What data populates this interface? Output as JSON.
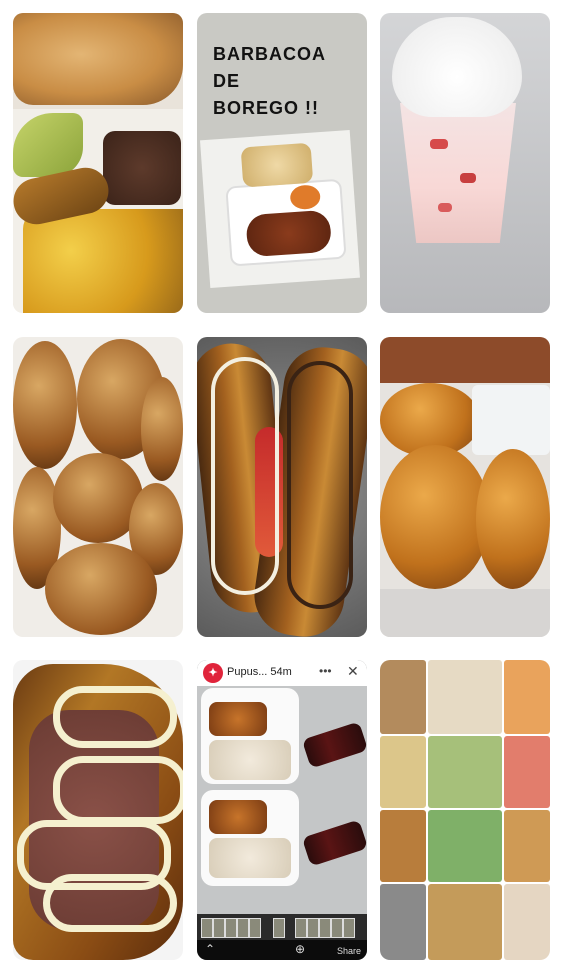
{
  "tiles": [
    {
      "id": "plate-breakfast"
    },
    {
      "id": "barbacoa",
      "headline_lines": [
        "BARBACOA",
        "DE",
        "BOREGO !!"
      ]
    },
    {
      "id": "dessert-cup"
    },
    {
      "id": "sugared-fritters"
    },
    {
      "id": "fried-plantains-sauce"
    },
    {
      "id": "empanadas"
    },
    {
      "id": "plantain-cream"
    },
    {
      "id": "story-screenshot",
      "story": {
        "account": "Pupus...",
        "time": "54m",
        "avatar_letter": "✦",
        "more_icon": "more-icon",
        "close_icon": "close-icon",
        "share_label": "Share"
      }
    },
    {
      "id": "collage"
    }
  ]
}
